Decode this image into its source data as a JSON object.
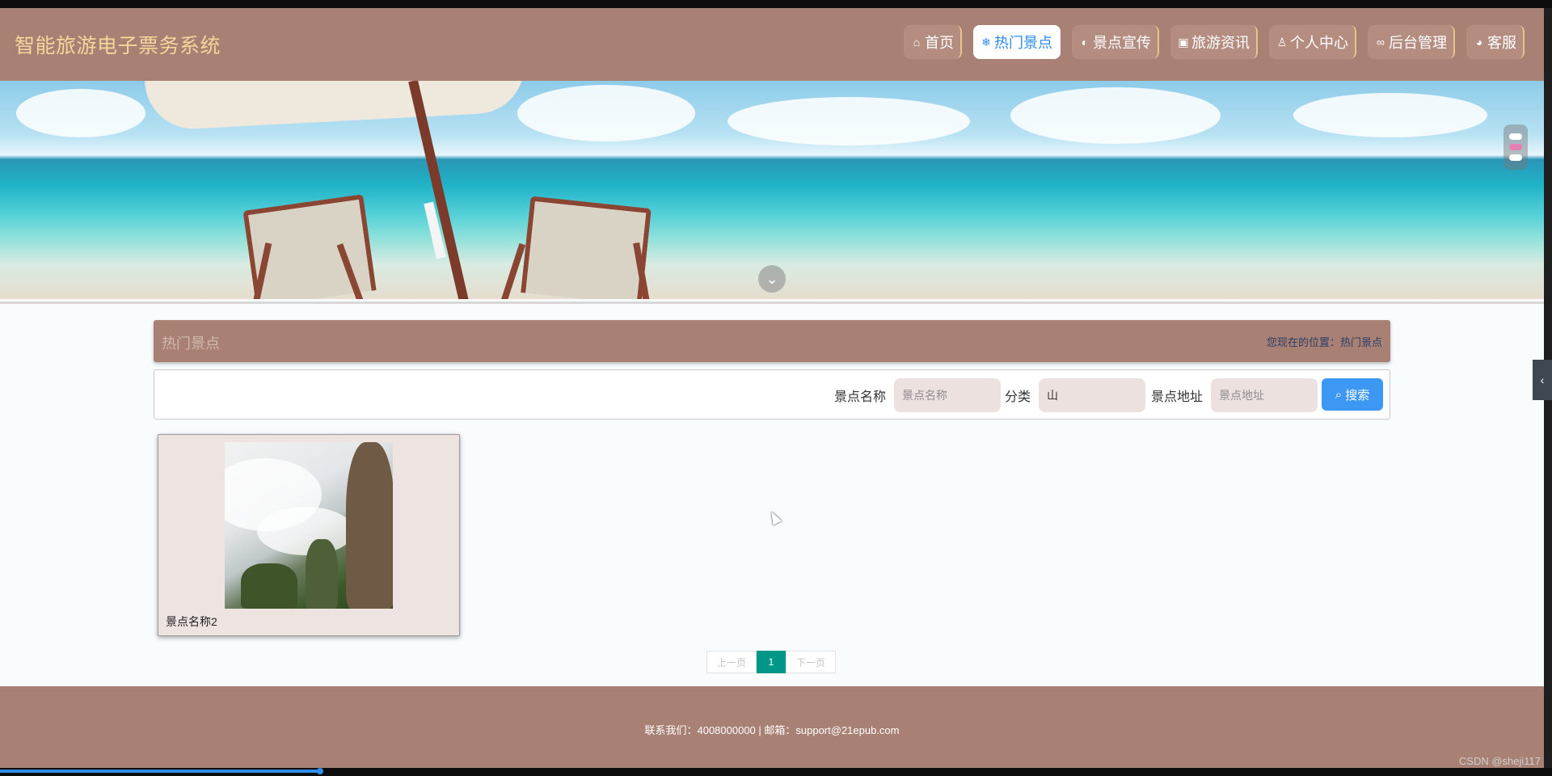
{
  "header": {
    "brand": "智能旅游电子票务系统",
    "nav": [
      {
        "label": "首页",
        "icon": "home-icon",
        "glyph": "⌂"
      },
      {
        "label": "热门景点",
        "icon": "snowflake-icon",
        "glyph": "❄"
      },
      {
        "label": "景点宣传",
        "icon": "palette-icon",
        "glyph": "◐"
      },
      {
        "label": "旅游资讯",
        "icon": "gift-icon",
        "glyph": "▣"
      },
      {
        "label": "个人中心",
        "icon": "user-icon",
        "glyph": "♙"
      },
      {
        "label": "后台管理",
        "icon": "link-icon",
        "glyph": "∞"
      },
      {
        "label": "客服",
        "icon": "headset-icon",
        "glyph": "◕"
      }
    ],
    "active_nav": "热门景点"
  },
  "banner": {
    "down_icon": "chevron-down-icon",
    "carousel_dots": 3,
    "active_dot": 2
  },
  "section": {
    "title": "热门景点",
    "breadcrumb": "您现在的位置：热门景点"
  },
  "search": {
    "name_label": "景点名称",
    "name_placeholder": "景点名称",
    "name_value": "",
    "category_label": "分类",
    "category_value": "山",
    "address_label": "景点地址",
    "address_placeholder": "景点地址",
    "address_value": "",
    "button_label": "搜索",
    "button_icon": "search-icon"
  },
  "results": [
    {
      "name": "景点名称2"
    }
  ],
  "pagination": {
    "prev": "上一页",
    "current": "1",
    "next": "下一页"
  },
  "footer": {
    "contact": "联系我们：4008000000 | 邮箱：support@21epub.com"
  },
  "watermark": "CSDN @sheji117",
  "colors": {
    "header_bg": "#a88074",
    "brand": "#f4d59a",
    "active_nav_text": "#2d8cf0",
    "search_button": "#3d98f4",
    "pager_active": "#009688"
  }
}
